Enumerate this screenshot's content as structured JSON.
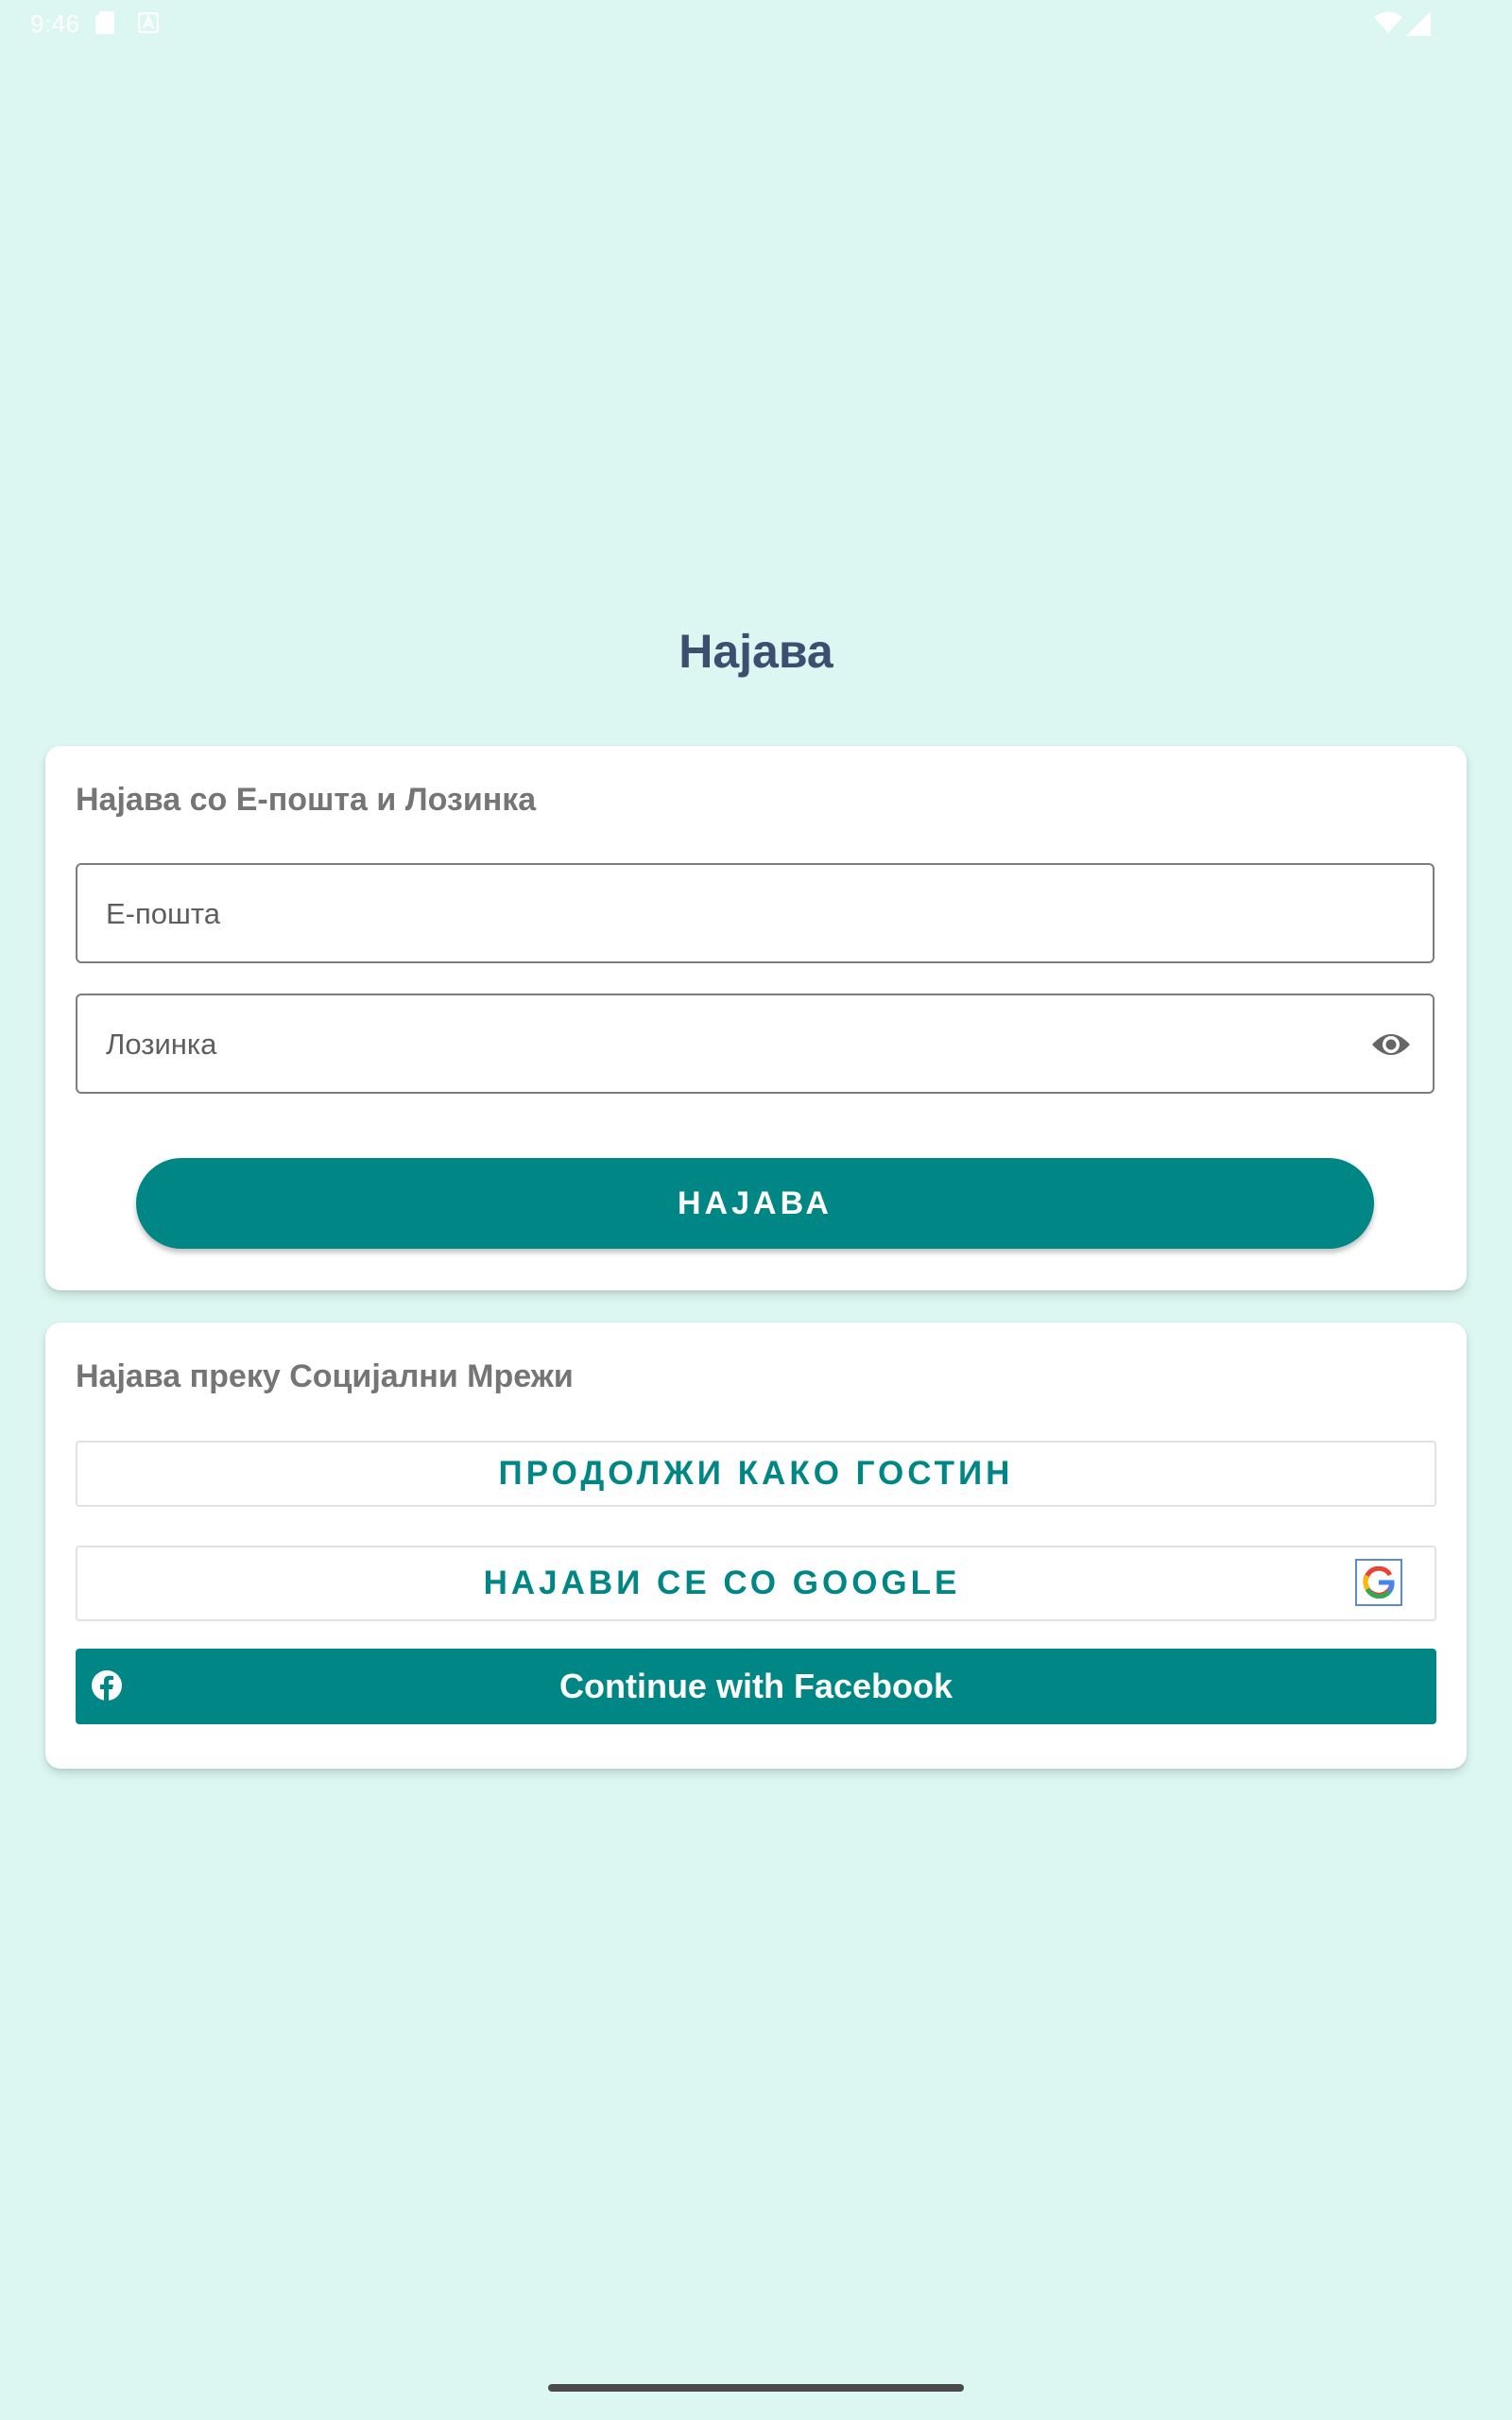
{
  "status_bar": {
    "time": "9:46",
    "icons": [
      "sd-card-icon",
      "app-notification-icon",
      "wifi-icon",
      "signal-icon"
    ]
  },
  "page": {
    "title": "Најава"
  },
  "email_login": {
    "section_title": "Најава со Е-пошта и Лозинка",
    "email_label": "Е-пошта",
    "password_label": "Лозинка",
    "login_button": "НАЈАВА"
  },
  "social_login": {
    "section_title": "Најава преку Социјални Мрежи",
    "guest_button": "ПРОДОЛЖИ КАКО ГОСТИН",
    "google_button": "НАЈАВИ СЕ СО GOOGLE",
    "facebook_button": "Continue with Facebook"
  },
  "colors": {
    "background": "#dcf7f1",
    "primary": "#008785",
    "title": "#3c4f70",
    "section_title": "#757575"
  }
}
